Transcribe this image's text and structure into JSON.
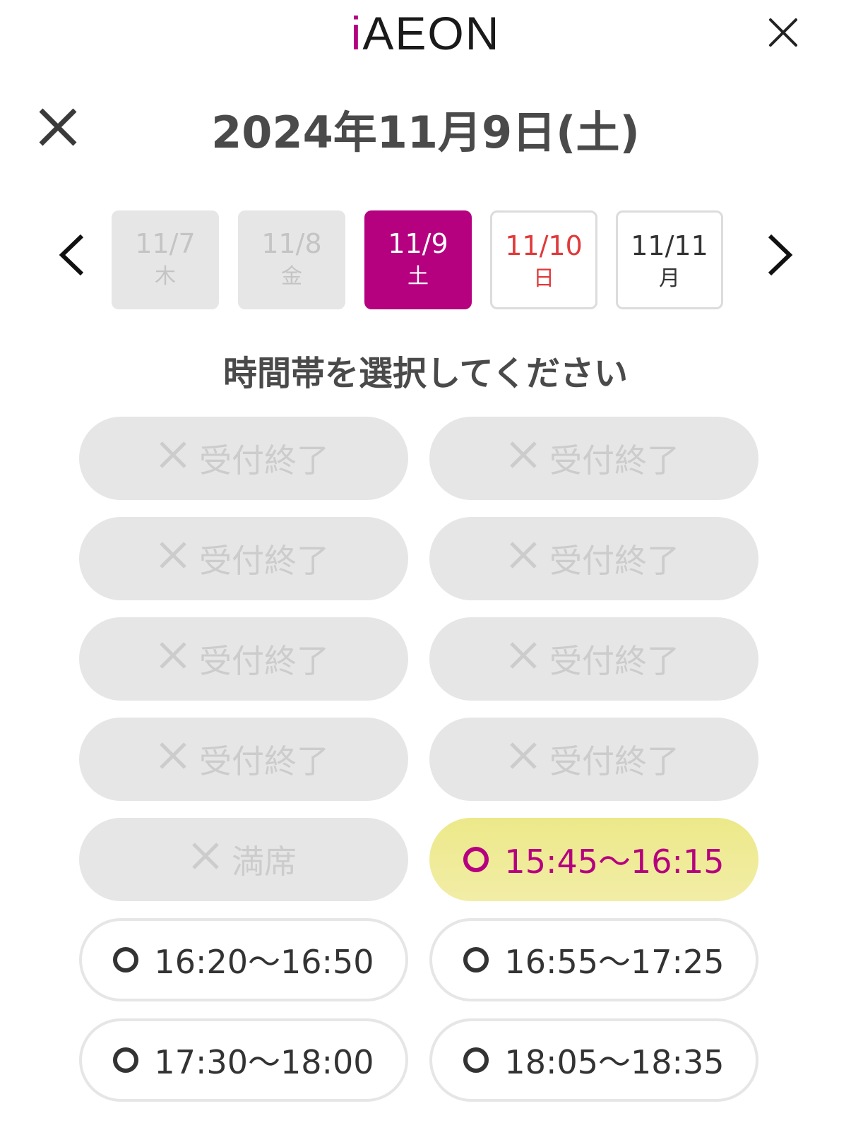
{
  "header": {
    "logo_prefix": "i",
    "logo_text": "AEON"
  },
  "title": "2024年11月9日(土)",
  "dates": [
    {
      "date": "11/7",
      "weekday": "木",
      "state": "past"
    },
    {
      "date": "11/8",
      "weekday": "金",
      "state": "past"
    },
    {
      "date": "11/9",
      "weekday": "土",
      "state": "selected"
    },
    {
      "date": "11/10",
      "weekday": "日",
      "state": "sunday"
    },
    {
      "date": "11/11",
      "weekday": "月",
      "state": "normal"
    }
  ],
  "prompt": "時間帯を選択してください",
  "slots": [
    {
      "label": "受付終了",
      "status": "closed"
    },
    {
      "label": "受付終了",
      "status": "closed"
    },
    {
      "label": "受付終了",
      "status": "closed"
    },
    {
      "label": "受付終了",
      "status": "closed"
    },
    {
      "label": "受付終了",
      "status": "closed"
    },
    {
      "label": "受付終了",
      "status": "closed"
    },
    {
      "label": "受付終了",
      "status": "closed"
    },
    {
      "label": "受付終了",
      "status": "closed"
    },
    {
      "label": "満席",
      "status": "full"
    },
    {
      "label": "15:45〜16:15",
      "status": "selected"
    },
    {
      "label": "16:20〜16:50",
      "status": "open"
    },
    {
      "label": "16:55〜17:25",
      "status": "open"
    },
    {
      "label": "17:30〜18:00",
      "status": "open"
    },
    {
      "label": "18:05〜18:35",
      "status": "open"
    }
  ],
  "colors": {
    "brand": "#b5007f",
    "sunday": "#e03a3a",
    "selected_slot": "#ece98a",
    "disabled": "#e6e6e6"
  },
  "icons": {
    "app_close": "close-icon",
    "modal_close": "close-icon",
    "prev": "chevron-left-icon",
    "next": "chevron-right-icon",
    "unavailable": "cross-mark-icon",
    "available": "circle-mark-icon"
  }
}
